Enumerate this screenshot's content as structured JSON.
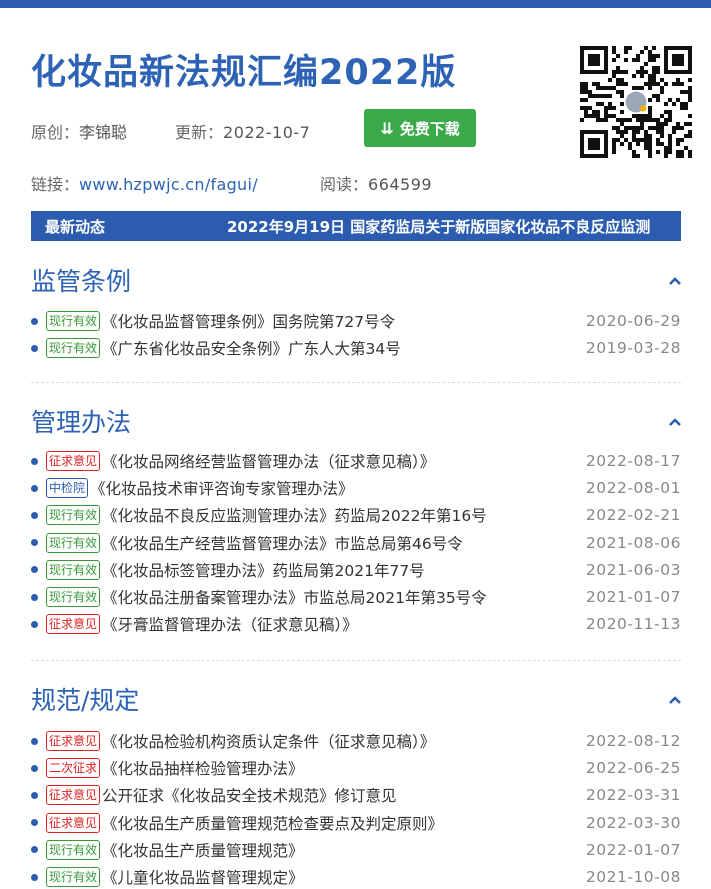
{
  "header": {
    "title": "化妆品新法规汇编2022版",
    "author_label": "原创：",
    "author": "李锦聪",
    "updated_label": "更新：",
    "updated": "2022-10-7",
    "download_label": "免费下载",
    "link_label": "链接：",
    "link": "www.hzpwjc.cn/fagui/",
    "reads_label": "阅读：",
    "reads": "664599"
  },
  "news": {
    "label": "最新动态",
    "text": "2022年9月19日 国家药监局关于新版国家化妆品不良反应监测"
  },
  "colors": {
    "primary": "#2b5cb0",
    "green": "#3a9a3a",
    "red": "#dd2222",
    "button": "#3aa94a"
  },
  "sections": [
    {
      "title": "监管条例",
      "items": [
        {
          "badge": "现行有效",
          "badge_color": "green",
          "title": "《化妆品监督管理条例》国务院第727号令",
          "date": "2020-06-29"
        },
        {
          "badge": "现行有效",
          "badge_color": "green",
          "title": "《广东省化妆品安全条例》广东人大第34号",
          "date": "2019-03-28"
        }
      ]
    },
    {
      "title": "管理办法",
      "items": [
        {
          "badge": "征求意见",
          "badge_color": "red",
          "title": "《化妆品网络经营监督管理办法（征求意见稿）》",
          "date": "2022-08-17"
        },
        {
          "badge": "中检院",
          "badge_color": "blue",
          "title": "《化妆品技术审评咨询专家管理办法》",
          "date": "2022-08-01"
        },
        {
          "badge": "现行有效",
          "badge_color": "green",
          "title": "《化妆品不良反应监测管理办法》药监局2022年第16号",
          "date": "2022-02-21"
        },
        {
          "badge": "现行有效",
          "badge_color": "green",
          "title": "《化妆品生产经营监督管理办法》市监总局第46号令",
          "date": "2021-08-06"
        },
        {
          "badge": "现行有效",
          "badge_color": "green",
          "title": "《化妆品标签管理办法》药监局第2021年77号",
          "date": "2021-06-03"
        },
        {
          "badge": "现行有效",
          "badge_color": "green",
          "title": "《化妆品注册备案管理办法》市监总局2021年第35号令",
          "date": "2021-01-07"
        },
        {
          "badge": "征求意见",
          "badge_color": "red",
          "title": "《牙膏监督管理办法（征求意见稿）》",
          "date": "2020-11-13"
        }
      ]
    },
    {
      "title": "规范/规定",
      "items": [
        {
          "badge": "征求意见",
          "badge_color": "red",
          "title": "《化妆品检验机构资质认定条件（征求意见稿）》",
          "date": "2022-08-12"
        },
        {
          "badge": "二次征求",
          "badge_color": "red",
          "title": "《化妆品抽样检验管理办法》",
          "date": "2022-06-25"
        },
        {
          "badge": "征求意见",
          "badge_color": "red",
          "title": "公开征求《化妆品安全技术规范》修订意见",
          "date": "2022-03-31"
        },
        {
          "badge": "征求意见",
          "badge_color": "red",
          "title": "《化妆品生产质量管理规范检查要点及判定原则》",
          "date": "2022-03-30"
        },
        {
          "badge": "现行有效",
          "badge_color": "green",
          "title": "《化妆品生产质量管理规范》",
          "date": "2022-01-07"
        },
        {
          "badge": "现行有效",
          "badge_color": "green",
          "title": "《儿童化妆品监督管理规定》",
          "date": "2021-10-08"
        }
      ]
    }
  ]
}
